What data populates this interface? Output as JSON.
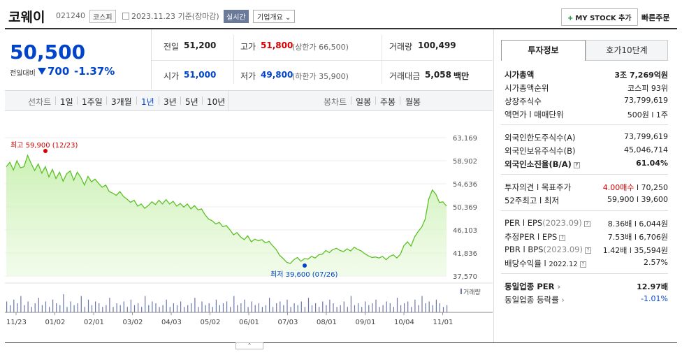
{
  "header": {
    "name": "코웨이",
    "code": "021240",
    "market_badge": "코스피",
    "date": "2023.11.23 기준(장마감)",
    "live_label": "실시간",
    "corp_label": "기업개요",
    "mystock_label": "MY STOCK 추가",
    "quick_order": "빠른주문"
  },
  "price": {
    "current": "50,500",
    "change_label": "전일대비",
    "change": "700",
    "change_pct": "-1.37%"
  },
  "quote": {
    "prev_label": "전일",
    "prev": "51,200",
    "high_label": "고가",
    "high": "51,800",
    "upper_limit": "(상한가 66,500)",
    "volume_label": "거래량",
    "volume": "100,499",
    "open_label": "시가",
    "open": "51,000",
    "low_label": "저가",
    "low": "49,800",
    "lower_limit": "(하한가 35,900)",
    "amount_label": "거래대금",
    "amount": "5,058",
    "amount_unit": "백만"
  },
  "nav": {
    "line_label": "선차트",
    "periods": [
      "1일",
      "1주일",
      "3개월",
      "1년",
      "3년",
      "5년",
      "10년"
    ],
    "selected_period": "1년",
    "candle_label": "봉차트",
    "candles": [
      "일봉",
      "주봉",
      "월봉"
    ]
  },
  "chart_data": {
    "type": "area",
    "x_ticks": [
      "11/23",
      "01/02",
      "02/01",
      "03/02",
      "04/03",
      "05/02",
      "06/01",
      "07/03",
      "08/01",
      "09/01",
      "10/04",
      "11/01"
    ],
    "y_ticks": [
      "63,169",
      "58,902",
      "54,636",
      "50,369",
      "46,103",
      "41,836",
      "37,570"
    ],
    "ylim": [
      37570,
      63169
    ],
    "max_label": "최고 59,900 (12/23)",
    "min_label": "최저 39,600 (07/26)",
    "volume_label": "거래량",
    "series": [
      {
        "values": [
          57800,
          58600,
          57200,
          58900,
          57600,
          57800,
          59900,
          58400,
          57100,
          58300,
          56600,
          57800,
          55900,
          57300,
          55600,
          56800,
          55100,
          56500,
          57000,
          55300,
          56800,
          55800,
          54400,
          56000,
          55000,
          55500,
          54700,
          54000,
          54400,
          53200,
          52900,
          52500,
          53200,
          52300,
          51800,
          51200,
          51600,
          50500,
          50900,
          50100,
          50600,
          51300,
          50800,
          51600,
          50900,
          51700,
          50900,
          51400,
          50500,
          51000,
          50300,
          50900,
          50000,
          50600,
          49800,
          50000,
          48900,
          48100,
          47800,
          47200,
          47500,
          46700,
          46900,
          46100,
          45200,
          45600,
          44800,
          44300,
          45000,
          43900,
          44400,
          44100,
          44300,
          43700,
          44000,
          43200,
          42500,
          41400,
          40800,
          40100,
          39900,
          40600,
          41000,
          40300,
          40800,
          40700,
          41200,
          40900,
          41500,
          41600,
          42300,
          41900,
          42500,
          42700,
          42300,
          42100,
          42600,
          42200,
          42900,
          42500,
          42200,
          41700,
          41300,
          41000,
          41100,
          40900,
          41200,
          40600,
          41200,
          41500,
          40900,
          41600,
          43200,
          43900,
          43100,
          44800,
          45800,
          46600,
          48100,
          51800,
          53500,
          52700,
          51200,
          51300,
          50500
        ]
      }
    ],
    "volume_values": [
      6,
      4,
      7,
      5,
      9,
      4,
      6,
      3,
      5,
      8,
      4,
      6,
      3,
      7,
      5,
      4,
      10,
      3,
      6,
      4,
      5,
      9,
      3,
      7,
      4,
      6,
      5,
      3,
      4,
      8,
      3,
      5,
      4,
      6,
      3,
      7,
      4,
      5,
      3,
      9,
      4,
      6,
      5,
      3,
      4,
      7,
      3,
      5,
      4,
      6,
      3,
      4,
      5,
      8,
      3,
      6,
      4,
      5,
      3,
      7,
      4,
      5,
      6,
      3,
      9,
      4,
      5,
      7,
      3,
      6,
      4,
      5,
      3,
      4,
      8,
      3,
      5,
      6,
      4,
      7,
      3,
      5,
      4,
      6,
      3,
      8,
      4,
      5,
      3,
      6,
      4,
      7,
      5,
      3,
      4,
      6,
      3,
      9,
      4,
      5,
      3,
      6,
      4,
      5,
      7,
      3,
      4,
      6,
      5,
      3,
      8,
      4,
      5,
      6,
      3,
      7,
      4,
      9,
      5,
      6,
      4,
      7,
      5,
      3,
      4
    ]
  },
  "invest": {
    "tab1": "투자정보",
    "tab2": "호가10단계",
    "rows1": [
      {
        "label": "시가총액",
        "value": "3조 7,269억원"
      },
      {
        "label": "시가총액순위",
        "value": "코스피 93위"
      },
      {
        "label": "상장주식수",
        "value": "73,799,619"
      },
      {
        "label": "액면가 l 매매단위",
        "value": "500원 l 1주"
      }
    ],
    "rows2": [
      {
        "label": "외국인한도주식수(A)",
        "value": "73,799,619"
      },
      {
        "label": "외국인보유주식수(B)",
        "value": "45,046,714"
      },
      {
        "label": "외국인소진율(B/A)",
        "value": "61.04%"
      }
    ],
    "rows3": [
      {
        "label": "투자의견 l 목표주가",
        "opinion": "4.00매수",
        "target": "l 70,250"
      },
      {
        "label": "52주최고 l 최저",
        "value": "59,900 l 39,600"
      }
    ],
    "rows4": [
      {
        "label": "PER l EPS",
        "date": "(2023.09)",
        "value": "8.36배 l 6,044원"
      },
      {
        "label": "추정PER l EPS",
        "date": "",
        "value": "7.53배 l 6,706원"
      },
      {
        "label": "PBR l BPS",
        "date": "(2023.09)",
        "value": "1.42배 l 35,594원"
      },
      {
        "label": "배당수익률 l",
        "date": "2022.12",
        "value": "2.57%"
      }
    ],
    "rows5": [
      {
        "label": "동일업종 PER",
        "value": "12.97배"
      },
      {
        "label": "동일업종 등락률",
        "value": "-1.01%"
      }
    ]
  },
  "colors": {
    "accent_blue": "#0044cc",
    "up_red": "#d60000",
    "line_green": "#5cc125",
    "fill_green": "#c8f0b0"
  }
}
